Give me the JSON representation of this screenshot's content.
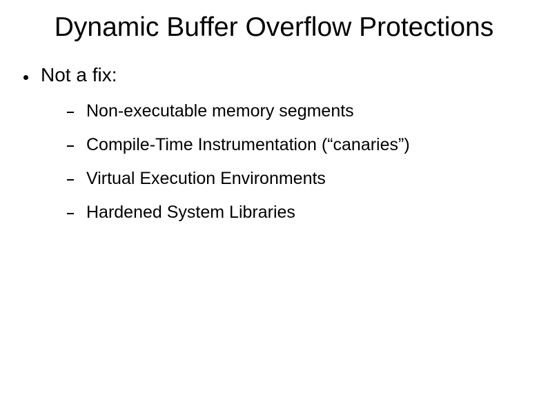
{
  "title": "Dynamic Buffer Overflow Protections",
  "mainBullet": "Not a fix:",
  "subItems": [
    "Non-executable memory segments",
    "Compile-Time Instrumentation (“canaries”)",
    "Virtual Execution Environments",
    "Hardened System Libraries"
  ]
}
